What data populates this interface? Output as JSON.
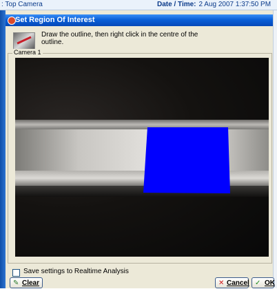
{
  "topbar": {
    "camera_name": ": Top Camera",
    "datetime_label": "Date / Time:",
    "datetime_value": "2 Aug 2007   1:37:50 PM"
  },
  "dialog": {
    "title": "Set Region Of Interest",
    "instruction": "Draw the outline, then right click in the centre of the outline.",
    "group_label": "Camera 1",
    "roi_color": "#0000ff",
    "save_checkbox": {
      "label": "Save settings to Realtime Analysis",
      "checked": false
    },
    "buttons": {
      "clear": "Clear",
      "cancel": "Cancel",
      "ok": "OK"
    }
  },
  "colors": {
    "title_bar": "#0a5fd8",
    "dialog_bg": "#ece9d8"
  },
  "icons": {
    "title": "app-icon",
    "instruction": "roi-tool-icon",
    "clear": "pencil-icon",
    "cancel": "x-icon",
    "ok": "check-icon"
  }
}
